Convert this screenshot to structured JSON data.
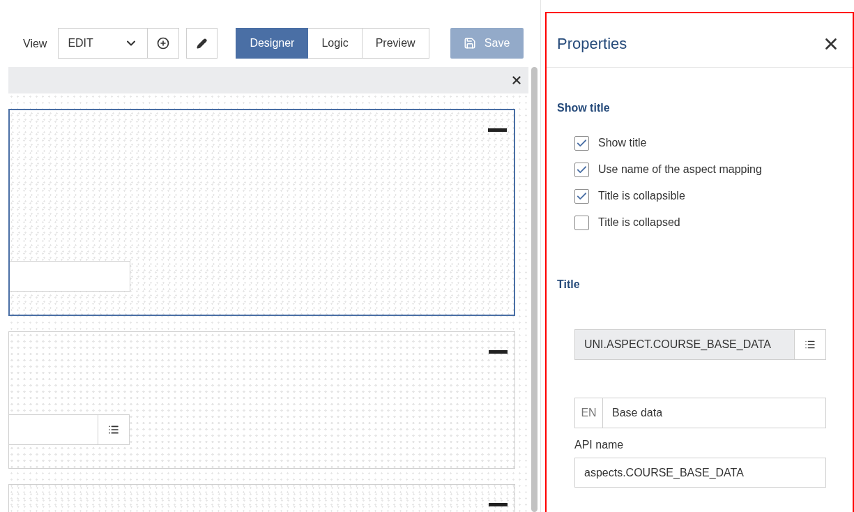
{
  "toolbar": {
    "view_label": "View",
    "view_select": {
      "value": "EDIT"
    },
    "modes": [
      {
        "label": "Designer",
        "selected": true
      },
      {
        "label": "Logic",
        "selected": false
      },
      {
        "label": "Preview",
        "selected": false
      }
    ],
    "save": {
      "label": "Save",
      "disabled": true
    }
  },
  "canvas": {
    "cards": [
      {
        "selected": true,
        "kind": "text"
      },
      {
        "selected": false,
        "kind": "list"
      },
      {
        "selected": false,
        "kind": "cut"
      }
    ]
  },
  "properties": {
    "title": "Properties",
    "show_title_section": {
      "heading": "Show title",
      "options": [
        {
          "label": "Show title",
          "checked": true
        },
        {
          "label": "Use name of the aspect mapping",
          "checked": true
        },
        {
          "label": "Title is collapsible",
          "checked": true
        },
        {
          "label": "Title is collapsed",
          "checked": false
        }
      ]
    },
    "title_section": {
      "heading": "Title",
      "key_field": {
        "value": "UNI.ASPECT.COURSE_BASE_DATA",
        "disabled": true
      },
      "translation": {
        "language": "EN",
        "value": "Base data"
      },
      "api_name": {
        "label": "API name",
        "value": "aspects.COURSE_BASE_DATA"
      }
    }
  }
}
